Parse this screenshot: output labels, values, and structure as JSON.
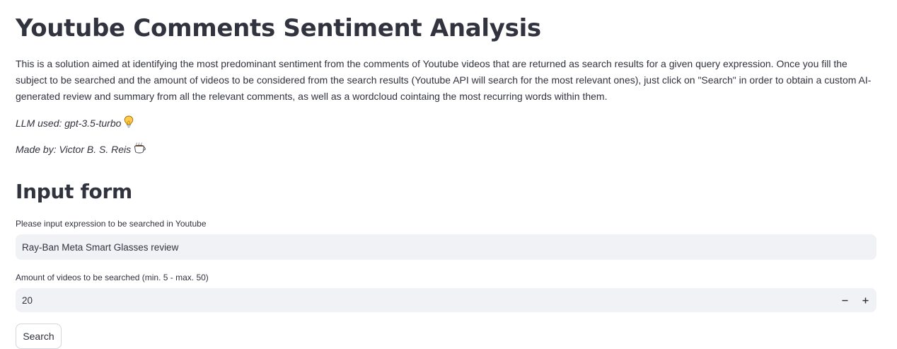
{
  "page": {
    "title": "Youtube Comments Sentiment Analysis",
    "intro": "This is a solution aimed at identifying the most predominant sentiment from the comments of Youtube videos that are returned as search results for a given query expression. Once you fill the subject to be searched and the amount of videos to be considered from the search results (Youtube API will search for the most relevant ones), just click on \"Search\" in order to obtain a custom AI-generated review and summary from all the relevant comments, as well as a wordcloud cointaing the most recurring words within them.",
    "llm_line": "LLM used: gpt-3.5-turbo",
    "llm_icon": "lightbulb-icon",
    "made_by_line": "Made by: Victor B. S. Reis",
    "made_by_icon": "coffee-cup-icon"
  },
  "form": {
    "section_title": "Input form",
    "query_label": "Please input expression to be searched in Youtube",
    "query_value": "Ray-Ban Meta Smart Glasses review",
    "amount_label": "Amount of videos to be searched (min. 5 - max. 50)",
    "amount_value": "20",
    "minus_icon": "minus-icon",
    "plus_icon": "plus-icon",
    "search_label": "Search"
  },
  "colors": {
    "text": "#31333f",
    "input_background": "#f0f2f6",
    "button_border": "#d3d5db"
  }
}
